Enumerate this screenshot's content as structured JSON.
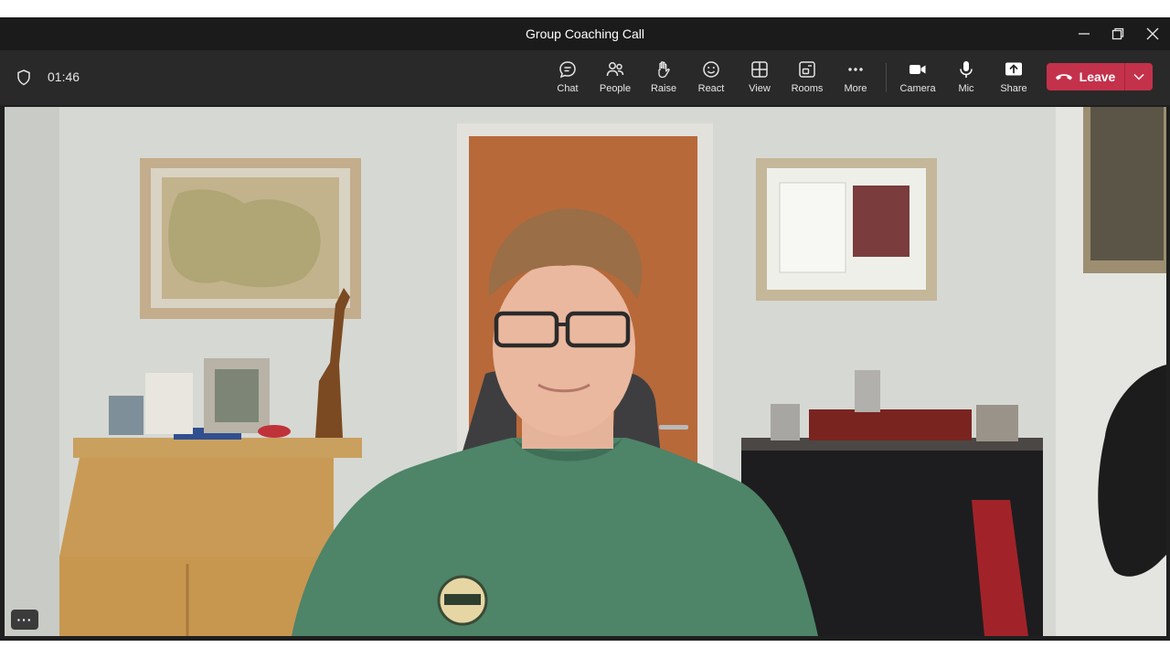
{
  "window": {
    "title": "Group Coaching Call",
    "controls": [
      "minimize-icon",
      "restore-icon",
      "close-icon"
    ]
  },
  "meeting": {
    "timer": "01:46",
    "security_icon": "shield-icon"
  },
  "toolbar": {
    "chat_label": "Chat",
    "people_label": "People",
    "raise_label": "Raise",
    "react_label": "React",
    "view_label": "View",
    "rooms_label": "Rooms",
    "more_label": "More",
    "camera_label": "Camera",
    "mic_label": "Mic",
    "share_label": "Share",
    "leave_label": "Leave"
  },
  "video": {
    "options_button": "···"
  },
  "colors": {
    "leave_red": "#c4314b",
    "toolbar_bg": "#292929",
    "titlebar_bg": "#1b1b1b"
  }
}
